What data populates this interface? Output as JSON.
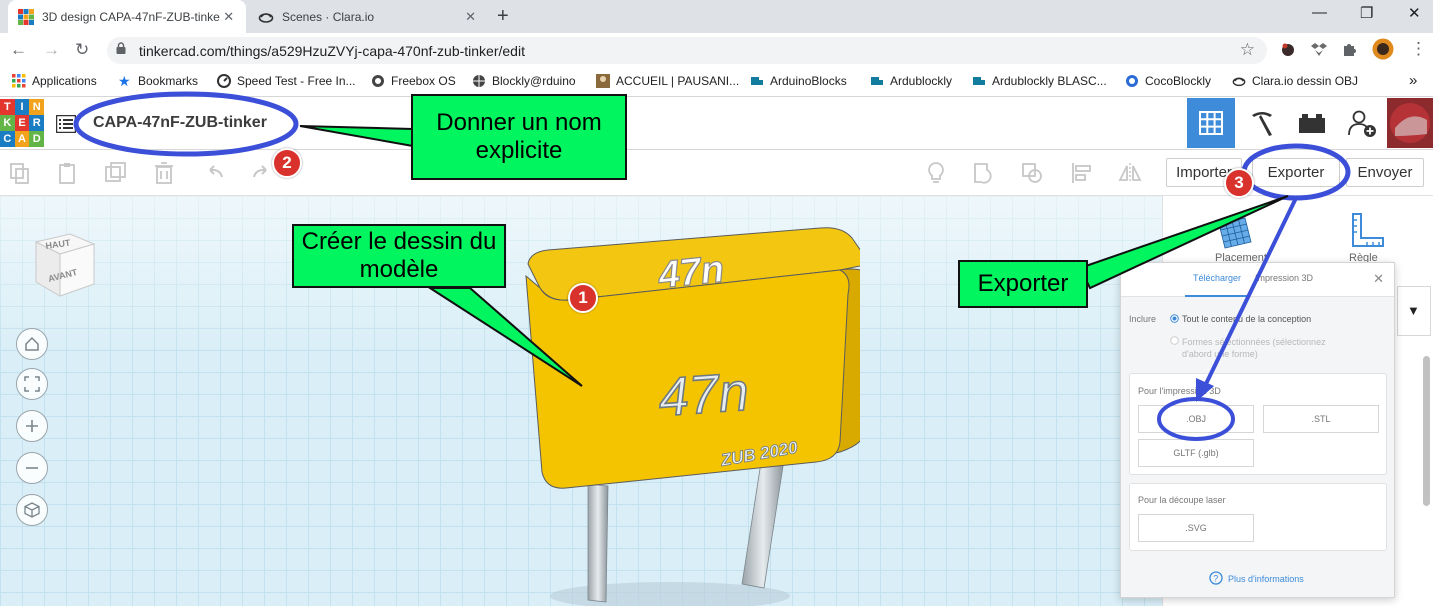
{
  "browser": {
    "tabs": [
      {
        "title": "3D design CAPA-47nF-ZUB-tinke",
        "active": true
      },
      {
        "title": "Scenes · Clara.io",
        "active": false
      }
    ],
    "url": "tinkercad.com/things/a529HzuZVYj-capa-470nf-zub-tinker/edit",
    "bookmarks": [
      "Applications",
      "Bookmarks",
      "Speed Test - Free In...",
      "Freebox OS",
      "Blockly@rduino",
      "ACCUEIL | PAUSANI...",
      "ArduinoBlocks",
      "Ardublockly",
      "Ardublockly BLASC...",
      "CocoBlockly",
      "Clara.io dessin OBJ"
    ],
    "more_bookmarks": "»"
  },
  "tinkercad": {
    "logo_letters": [
      "T",
      "I",
      "N",
      "K",
      "E",
      "R",
      "C",
      "A",
      "D"
    ],
    "design_name": "CAPA-47nF-ZUB-tinker",
    "toolbar": {
      "import_label": "Importer",
      "export_label": "Exporter",
      "send_label": "Envoyer"
    },
    "viewcube": {
      "top": "HAUT",
      "front": "AVANT"
    },
    "right_panel": {
      "shape_label_1": "Placement",
      "shape_label_2": "Règle"
    }
  },
  "model": {
    "top_text": "47n",
    "front_text": "47n",
    "small_text": "ZUB 2020"
  },
  "export_dialog": {
    "tab_download": "Télécharger",
    "tab_print": "Impression 3D",
    "include_label": "Inclure",
    "option_all": "Tout le contenu de la conception",
    "option_selected": "Formes sélectionnées (sélectionnez d'abord une forme)",
    "section_3d": "Pour l'impression 3D",
    "btn_obj": ".OBJ",
    "btn_stl": ".STL",
    "btn_gltf": "GLTF (.glb)",
    "section_laser": "Pour la découpe laser",
    "btn_svg": ".SVG",
    "more_info": "Plus d'informations"
  },
  "annotations": {
    "callout_name": "Donner un nom explicite",
    "callout_draw": "Créer le dessin du modèle",
    "callout_export": "Exporter",
    "badge_1": "1",
    "badge_2": "2",
    "badge_3": "3"
  },
  "colors": {
    "callout_green": "#00f55e",
    "highlight_blue": "#3b4fd8",
    "badge_red": "#d9312b",
    "tinkercad_blue": "#3d8bd9",
    "model_yellow": "#f5c400"
  }
}
